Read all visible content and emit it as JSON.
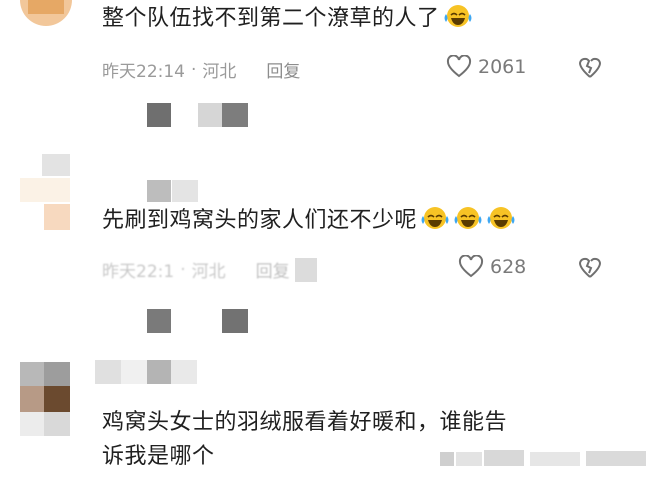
{
  "comments": [
    {
      "text": "整个队伍找不到第二个潦草的人了",
      "time": "昨天22:14",
      "location": "河北",
      "reply_label": "回复",
      "likes": "2061"
    },
    {
      "text": "先刷到鸡窝头的家人们还不少呢",
      "time": "昨天22:1",
      "location": "河北",
      "reply_label": "回复",
      "likes": "628"
    },
    {
      "text_line1": "鸡窝头女士的羽绒服看着好暖和，谁能告",
      "text_line2": "诉我是哪个"
    }
  ],
  "colors": {
    "text": "#202020",
    "meta": "#9a9a9a",
    "emoji_face": "#f7c325",
    "mosaic_dark": "#6f6f6f",
    "mosaic_light": "#d6d6d6"
  },
  "icons": {
    "like": "heart-outline-icon",
    "dislike": "broken-heart-icon",
    "emoji": "laughing-tears-emoji"
  }
}
